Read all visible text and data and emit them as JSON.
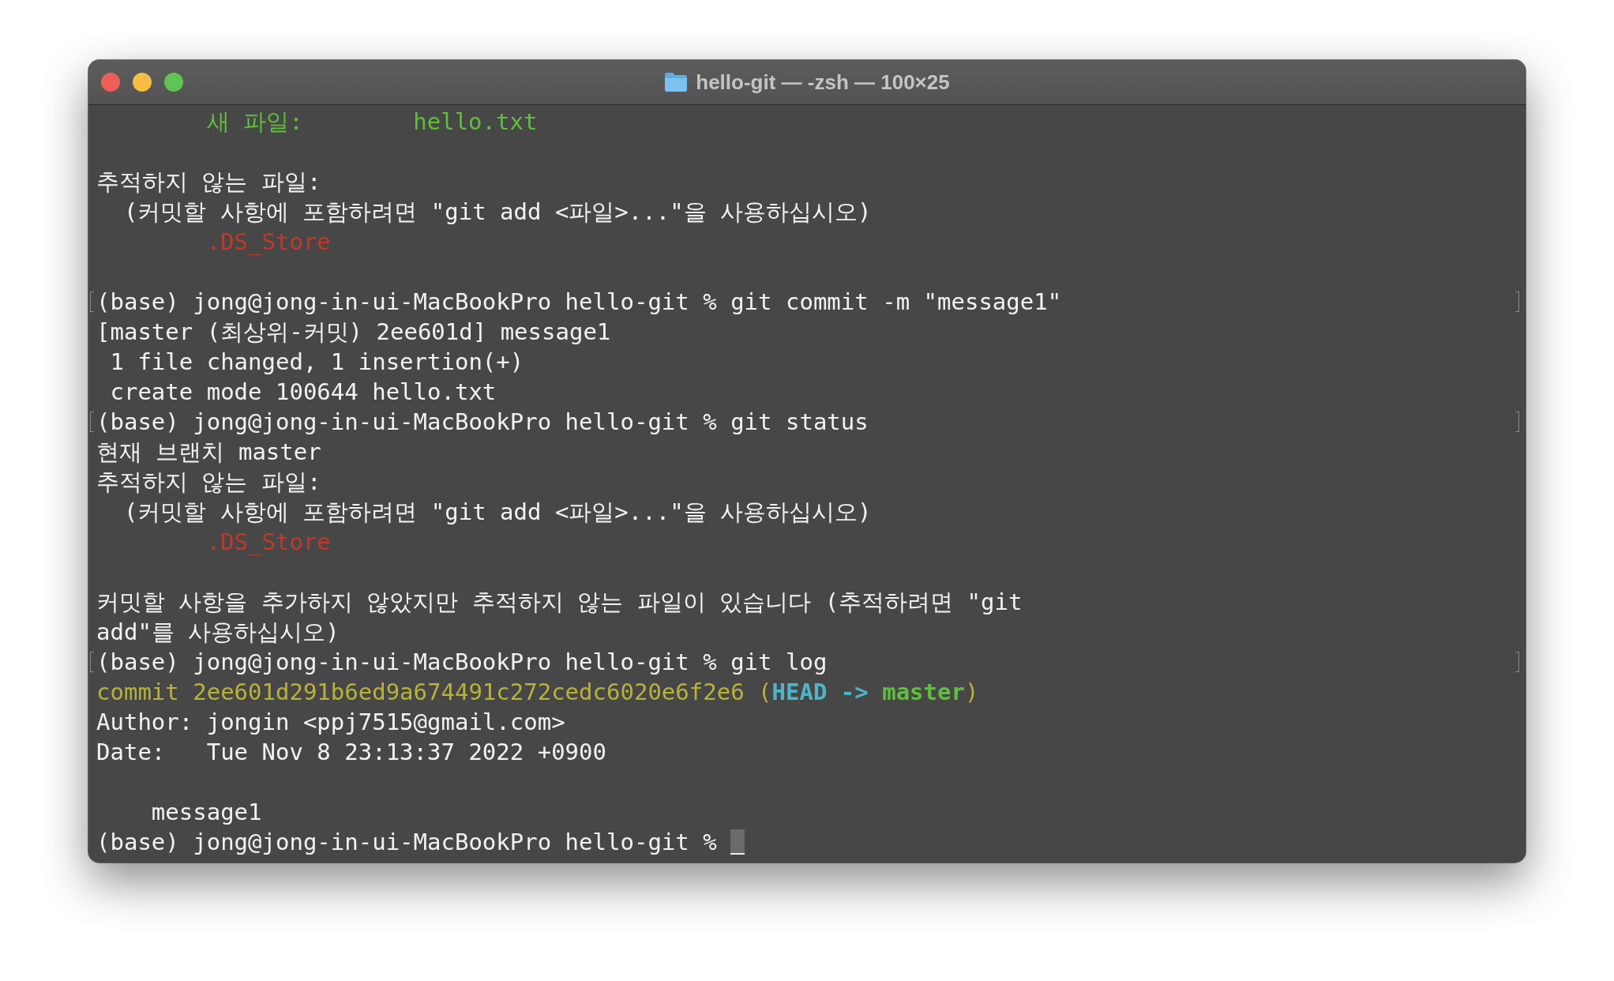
{
  "window": {
    "title": "hello-git — -zsh — 100×25"
  },
  "lines": [
    {
      "kind": "text",
      "segments": [
        {
          "kind": "added",
          "text": "        새 파일:        hello.txt"
        }
      ]
    },
    {
      "kind": "blank"
    },
    {
      "kind": "text",
      "segments": [
        {
          "kind": "plain",
          "text": "추적하지 않는 파일:"
        }
      ]
    },
    {
      "kind": "text",
      "segments": [
        {
          "kind": "plain",
          "text": "  (커밋할 사항에 포함하려면 \"git add <파일>...\"을 사용하십시오)"
        }
      ]
    },
    {
      "kind": "text",
      "segments": [
        {
          "kind": "untracked",
          "text": "        .DS_Store"
        }
      ]
    },
    {
      "kind": "blank"
    },
    {
      "kind": "prompt",
      "segments": [
        {
          "kind": "plain",
          "text": "(base) jong@jong-in-ui-MacBookPro hello-git % git commit -m \"message1\""
        }
      ]
    },
    {
      "kind": "text",
      "segments": [
        {
          "kind": "plain",
          "text": "[master (최상위-커밋) 2ee601d] message1"
        }
      ]
    },
    {
      "kind": "text",
      "segments": [
        {
          "kind": "plain",
          "text": " 1 file changed, 1 insertion(+)"
        }
      ]
    },
    {
      "kind": "text",
      "segments": [
        {
          "kind": "plain",
          "text": " create mode 100644 hello.txt"
        }
      ]
    },
    {
      "kind": "prompt",
      "segments": [
        {
          "kind": "plain",
          "text": "(base) jong@jong-in-ui-MacBookPro hello-git % git status"
        }
      ]
    },
    {
      "kind": "text",
      "segments": [
        {
          "kind": "plain",
          "text": "현재 브랜치 master"
        }
      ]
    },
    {
      "kind": "text",
      "segments": [
        {
          "kind": "plain",
          "text": "추적하지 않는 파일:"
        }
      ]
    },
    {
      "kind": "text",
      "segments": [
        {
          "kind": "plain",
          "text": "  (커밋할 사항에 포함하려면 \"git add <파일>...\"을 사용하십시오)"
        }
      ]
    },
    {
      "kind": "text",
      "segments": [
        {
          "kind": "untracked",
          "text": "        .DS_Store"
        }
      ]
    },
    {
      "kind": "blank"
    },
    {
      "kind": "text",
      "segments": [
        {
          "kind": "plain",
          "text": "커밋할 사항을 추가하지 않았지만 추적하지 않는 파일이 있습니다 (추적하려면 \"git"
        }
      ]
    },
    {
      "kind": "text",
      "segments": [
        {
          "kind": "plain",
          "text": "add\"를 사용하십시오)"
        }
      ]
    },
    {
      "kind": "prompt",
      "segments": [
        {
          "kind": "plain",
          "text": "(base) jong@jong-in-ui-MacBookPro hello-git % git log"
        }
      ]
    },
    {
      "kind": "text",
      "segments": [
        {
          "kind": "commit",
          "text": "commit 2ee601d291b6ed9a674491c272cedc6020e6f2e6 ("
        },
        {
          "kind": "head",
          "text": "HEAD -> "
        },
        {
          "kind": "branch",
          "text": "master"
        },
        {
          "kind": "commit",
          "text": ")"
        }
      ]
    },
    {
      "kind": "text",
      "segments": [
        {
          "kind": "plain",
          "text": "Author: jongin <ppj7515@gmail.com>"
        }
      ]
    },
    {
      "kind": "text",
      "segments": [
        {
          "kind": "plain",
          "text": "Date:   Tue Nov 8 23:13:37 2022 +0900"
        }
      ]
    },
    {
      "kind": "blank"
    },
    {
      "kind": "text",
      "segments": [
        {
          "kind": "plain",
          "text": "    message1"
        }
      ]
    },
    {
      "kind": "cursor",
      "segments": [
        {
          "kind": "plain",
          "text": "(base) jong@jong-in-ui-MacBookPro hello-git % "
        }
      ]
    }
  ]
}
